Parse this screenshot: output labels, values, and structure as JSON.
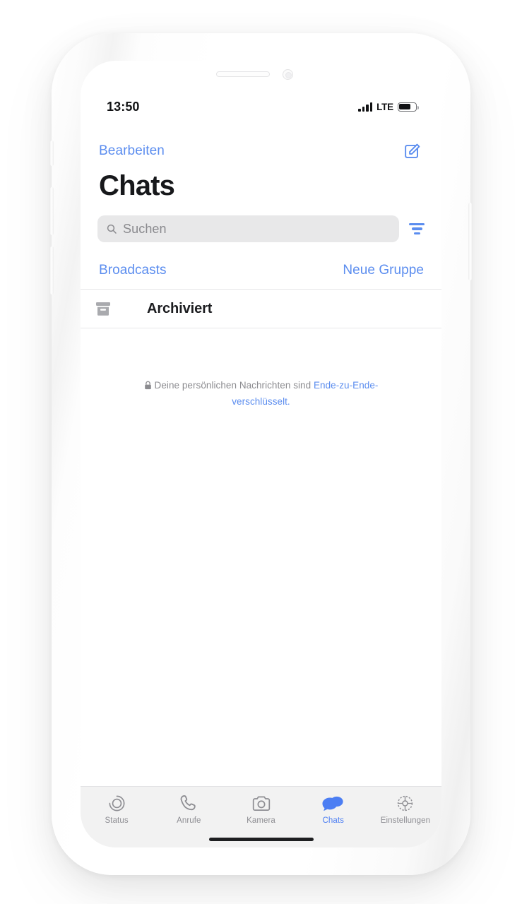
{
  "device": {
    "frame_color": "#fafafa",
    "screen_background": "#ffffff"
  },
  "status_bar": {
    "time": "13:50",
    "network_label": "LTE",
    "signal_bars": 4,
    "battery_percent": 72,
    "signal_icon": "signal-bars-icon",
    "battery_icon": "battery-icon"
  },
  "header": {
    "edit_label": "Bearbeiten",
    "compose_icon": "compose-icon",
    "title": "Chats",
    "accent_color": "#5b8def"
  },
  "search": {
    "placeholder": "Suchen",
    "value": "",
    "search_icon": "search-icon",
    "filter_icon": "filter-icon",
    "background": "#e8e8e9"
  },
  "quick_links": [
    {
      "label": "Broadcasts",
      "name": "broadcasts-link"
    },
    {
      "label": "Neue Gruppe",
      "name": "new-group-link"
    }
  ],
  "archived": {
    "label": "Archiviert",
    "icon": "archive-box-icon"
  },
  "encryption_notice": {
    "lock_icon": "lock-icon",
    "text_before": "Deine persönlichen Nachrichten sind ",
    "link_text": "Ende-zu-Ende-verschlüsselt.",
    "link_color": "#5b8def"
  },
  "chat_list": {
    "items": [],
    "empty": true
  },
  "tab_bar": {
    "background": "#f2f2f2",
    "active_color": "#4c7ef3",
    "inactive_color": "#8e8e93",
    "items": [
      {
        "label": "Status",
        "icon": "status-rings-icon",
        "active": false
      },
      {
        "label": "Anrufe",
        "icon": "phone-icon",
        "active": false
      },
      {
        "label": "Kamera",
        "icon": "camera-icon",
        "active": false
      },
      {
        "label": "Chats",
        "icon": "chat-bubbles-icon",
        "active": true
      },
      {
        "label": "Einstellungen",
        "icon": "gear-icon",
        "active": false
      }
    ]
  },
  "home_indicator": {
    "visible": true
  }
}
